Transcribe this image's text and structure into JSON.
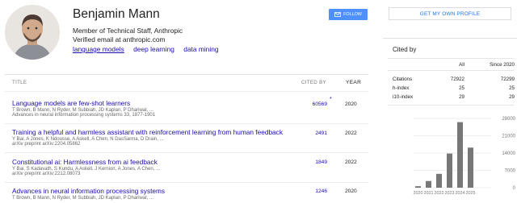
{
  "profile": {
    "name": "Benjamin Mann",
    "affiliation": "Member of Technical Staff, Anthropic",
    "email": "Verified email at anthropic.com",
    "interests": [
      "language models",
      "deep learning",
      "data mining"
    ],
    "follow_label": "FOLLOW",
    "get_profile_label": "GET MY OWN PROFILE"
  },
  "table": {
    "headers": {
      "title": "TITLE",
      "cited_by": "CITED BY",
      "year": "YEAR"
    },
    "articles": [
      {
        "title": "Language models are few-shot learners",
        "authors": "T Brown, B Mann, N Ryder, M Subbiah, JD Kaplan, P Dhariwal, ...",
        "venue": "Advances in neural information processing systems 33, 1877-1901",
        "cited_by": "60569",
        "star": "*",
        "year": "2020"
      },
      {
        "title": "Training a helpful and harmless assistant with reinforcement learning from human feedback",
        "authors": "Y Bai, A Jones, K Ndousse, A Askell, A Chen, N DasSarma, D Drain, ...",
        "venue": "arXiv preprint arXiv:2204.05862",
        "cited_by": "2491",
        "star": "",
        "year": "2022"
      },
      {
        "title": "Constitutional ai: Harmlessness from ai feedback",
        "authors": "Y Bai, S Kadavath, S Kundu, A Askell, J Kernion, A Jones, A Chen, ...",
        "venue": "arXiv preprint arXiv:2212.08073",
        "cited_by": "1849",
        "star": "",
        "year": "2022"
      },
      {
        "title": "Advances in neural information processing systems",
        "authors": "T Brown, B Mann, N Ryder, M Subbiah, JD Kaplan, P Dhariwal, ...",
        "venue": "",
        "cited_by": "1246",
        "star": "",
        "year": "2020"
      }
    ]
  },
  "cited_by_panel": {
    "title": "Cited by",
    "col_all": "All",
    "col_since": "Since 2020",
    "metrics": [
      {
        "label": "Citations",
        "all": "72922",
        "since": "72299"
      },
      {
        "label": "h-index",
        "all": "25",
        "since": "25"
      },
      {
        "label": "i10-index",
        "all": "29",
        "since": "29"
      }
    ]
  },
  "colors": {
    "link": "#1a0dab",
    "accent": "#4d90fe",
    "bar": "#777777"
  },
  "chart_data": {
    "type": "bar",
    "categories": [
      "2020",
      "2021",
      "2022",
      "2023",
      "2024",
      "2025"
    ],
    "values": [
      600,
      2700,
      5600,
      13800,
      26500,
      16200
    ],
    "yticks": [
      "28000",
      "21000",
      "14000",
      "7000",
      "0"
    ],
    "ylim": [
      0,
      28000
    ]
  }
}
